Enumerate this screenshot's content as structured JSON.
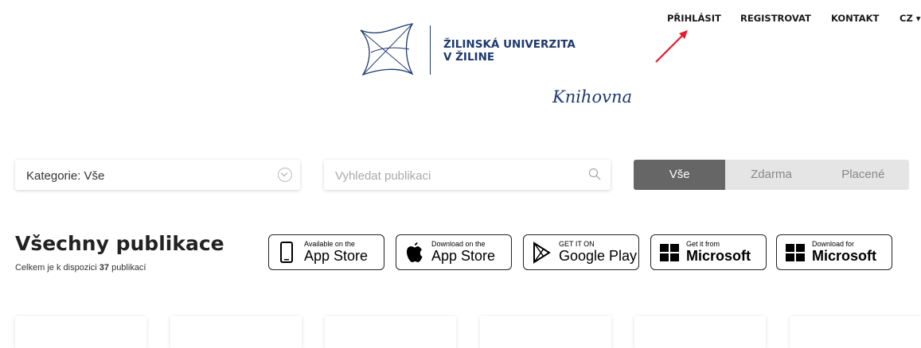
{
  "nav": {
    "login": "PŘIHLÁSIT",
    "register": "REGISTROVAT",
    "contact": "KONTAKT",
    "lang": "CZ ▾"
  },
  "logo": {
    "line1": "ŽILINSKÁ UNIVERZITA",
    "line2": "V ŽILINE",
    "subtitle": "Knihovna",
    "color": "#1e3a6e"
  },
  "filters": {
    "category": "Kategorie: Vše",
    "search_placeholder": "Vyhledat publikaci",
    "segments": [
      "Vše",
      "Zdarma",
      "Placené"
    ],
    "active_segment": "Vše"
  },
  "section": {
    "title": "Všechny publikace",
    "count_prefix": "Celkem je k dispozici ",
    "count": "37",
    "count_suffix": " publikací"
  },
  "stores": [
    {
      "small": "Available on the",
      "big": "App Store",
      "icon": "phone-icon"
    },
    {
      "small": "Download on the",
      "big": "App Store",
      "icon": "apple-icon"
    },
    {
      "small": "GET IT ON",
      "big": "Google Play",
      "icon": "play-icon"
    },
    {
      "small": "Get it from",
      "big": "Microsoft",
      "icon": "windows-icon"
    },
    {
      "small": "Download for",
      "big": "Microsoft",
      "icon": "windows-icon"
    }
  ],
  "cards_count": 6,
  "colors": {
    "annotation_arrow": "#e8192c",
    "segment_active": "#666666"
  }
}
